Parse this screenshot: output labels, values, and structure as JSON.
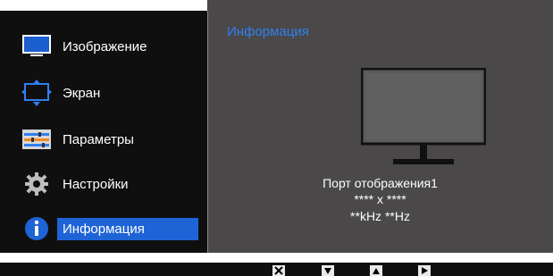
{
  "menu": {
    "items": [
      {
        "label": "Изображение",
        "icon": "monitor-icon"
      },
      {
        "label": "Экран",
        "icon": "screen-resize-icon"
      },
      {
        "label": "Параметры",
        "icon": "settings-sliders-icon"
      },
      {
        "label": "Настройки",
        "icon": "gear-icon"
      },
      {
        "label": "Информация",
        "icon": "info-icon",
        "selected": true
      }
    ]
  },
  "content": {
    "title": "Информация",
    "port": "Порт отображения1",
    "resolution": "**** x ****",
    "frequency": "**kHz **Hz"
  },
  "buttons": [
    {
      "icon": "close-icon"
    },
    {
      "icon": "down-arrow-icon"
    },
    {
      "icon": "up-arrow-icon"
    },
    {
      "icon": "right-arrow-icon"
    }
  ],
  "colors": {
    "accent": "#1f64d6",
    "title": "#2f7ff1",
    "panel": "#4a4848"
  }
}
